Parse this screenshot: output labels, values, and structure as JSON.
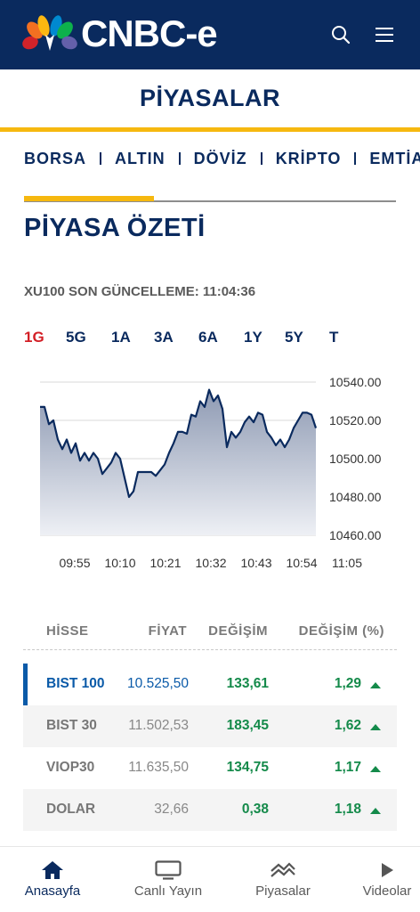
{
  "brand": {
    "name": "CNBC-e",
    "header_bg": "#0a2a5e",
    "accent": "#f6b80f",
    "up_color": "#148a4a",
    "active_period_color": "#d31f26"
  },
  "header": {
    "icons": [
      "search-icon",
      "menu-icon"
    ]
  },
  "section": {
    "title": "PİYASALAR"
  },
  "tabs": [
    "BORSA",
    "ALTIN",
    "DÖVİZ",
    "KRİPTO",
    "EMTİA"
  ],
  "page": {
    "heading": "PİYASA ÖZETİ",
    "update_label": "XU100 SON GÜNCELLEME: 11:04:36"
  },
  "periods": [
    {
      "label": "1G",
      "active": true
    },
    {
      "label": "5G"
    },
    {
      "label": "1A"
    },
    {
      "label": "3A"
    },
    {
      "label": "6A"
    },
    {
      "label": "1Y"
    },
    {
      "label": "5Y"
    },
    {
      "label": "T"
    }
  ],
  "chart_data": {
    "type": "area",
    "title": "",
    "xlabel": "",
    "ylabel": "",
    "x_ticks": [
      "09:55",
      "10:10",
      "10:21",
      "10:32",
      "10:43",
      "10:54",
      "11:05"
    ],
    "y_ticks": [
      "10540.00",
      "10520.00",
      "10500.00",
      "10480.00",
      "10460.00"
    ],
    "ylim": [
      10460,
      10540
    ],
    "grid": true,
    "series": [
      {
        "values": [
          10527,
          10527,
          10518,
          10520,
          10510,
          10505,
          10510,
          10503,
          10508,
          10499,
          10503,
          10499,
          10503,
          10500,
          10492,
          10495,
          10498,
          10503,
          10500,
          10490,
          10480,
          10483,
          10493,
          10493,
          10493,
          10493,
          10491,
          10494,
          10497,
          10503,
          10508,
          10514,
          10514,
          10513,
          10523,
          10522,
          10530,
          10527,
          10536,
          10530,
          10533,
          10526,
          10506,
          10514,
          10511,
          10514,
          10519,
          10522,
          10519,
          10524,
          10523,
          10514,
          10511,
          10507,
          10510,
          10506,
          10510,
          10516,
          10520,
          10524,
          10524,
          10523,
          10516
        ]
      }
    ]
  },
  "table": {
    "headers": {
      "name": "HİSSE",
      "price": "FİYAT",
      "change": "DEĞİŞİM",
      "change_pct": "DEĞİŞİM (%)"
    },
    "rows": [
      {
        "name": "BIST 100",
        "price": "10.525,50",
        "change": "133,61",
        "change_pct": "1,29",
        "selected": true
      },
      {
        "name": "BIST 30",
        "price": "11.502,53",
        "change": "183,45",
        "change_pct": "1,62"
      },
      {
        "name": "VIOP30",
        "price": "11.635,50",
        "change": "134,75",
        "change_pct": "1,17"
      },
      {
        "name": "DOLAR",
        "price": "32,66",
        "change": "0,38",
        "change_pct": "1,18"
      }
    ]
  },
  "bottom_nav": [
    {
      "label": "Anasayfa",
      "icon": "home-icon",
      "active": true
    },
    {
      "label": "Canlı Yayın",
      "icon": "tv-icon"
    },
    {
      "label": "Piyasalar",
      "icon": "markets-icon"
    },
    {
      "label": "Videolar",
      "icon": "play-icon"
    }
  ]
}
